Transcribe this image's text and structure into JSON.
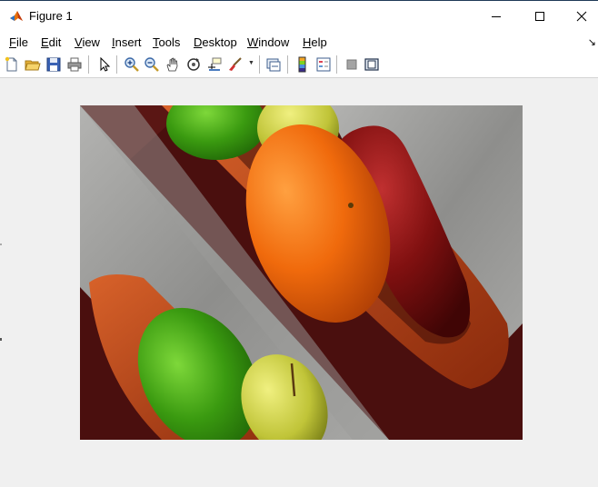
{
  "window": {
    "title": "Figure 1",
    "app_icon": "matlab-logo-icon",
    "controls": [
      "minimize-icon",
      "maximize-icon",
      "close-icon"
    ]
  },
  "menu": {
    "items": [
      "File",
      "Edit",
      "View",
      "Insert",
      "Tools",
      "Desktop",
      "Window",
      "Help"
    ]
  },
  "toolbar": {
    "buttons": [
      "new-figure-icon",
      "open-file-icon",
      "save-icon",
      "print-icon",
      "select-arrow-icon",
      "zoom-in-icon",
      "zoom-out-icon",
      "pan-hand-icon",
      "rotate-3d-icon",
      "data-cursor-icon",
      "brush-icon",
      "link-plot-icon",
      "colorbar-icon",
      "legend-icon",
      "hide-plot-tools-icon",
      "show-plot-tools-icon"
    ]
  },
  "figure": {
    "content": "image-display",
    "colors": {
      "wood_dark": "#4a0f0e",
      "wood_stripe": "#9a9a98",
      "bowl": "#b4461c",
      "orange": "#f07010",
      "red_pear": "#8a1414",
      "green_apple": "#3c9a10",
      "yellow_pear": "#c8cc40"
    }
  }
}
